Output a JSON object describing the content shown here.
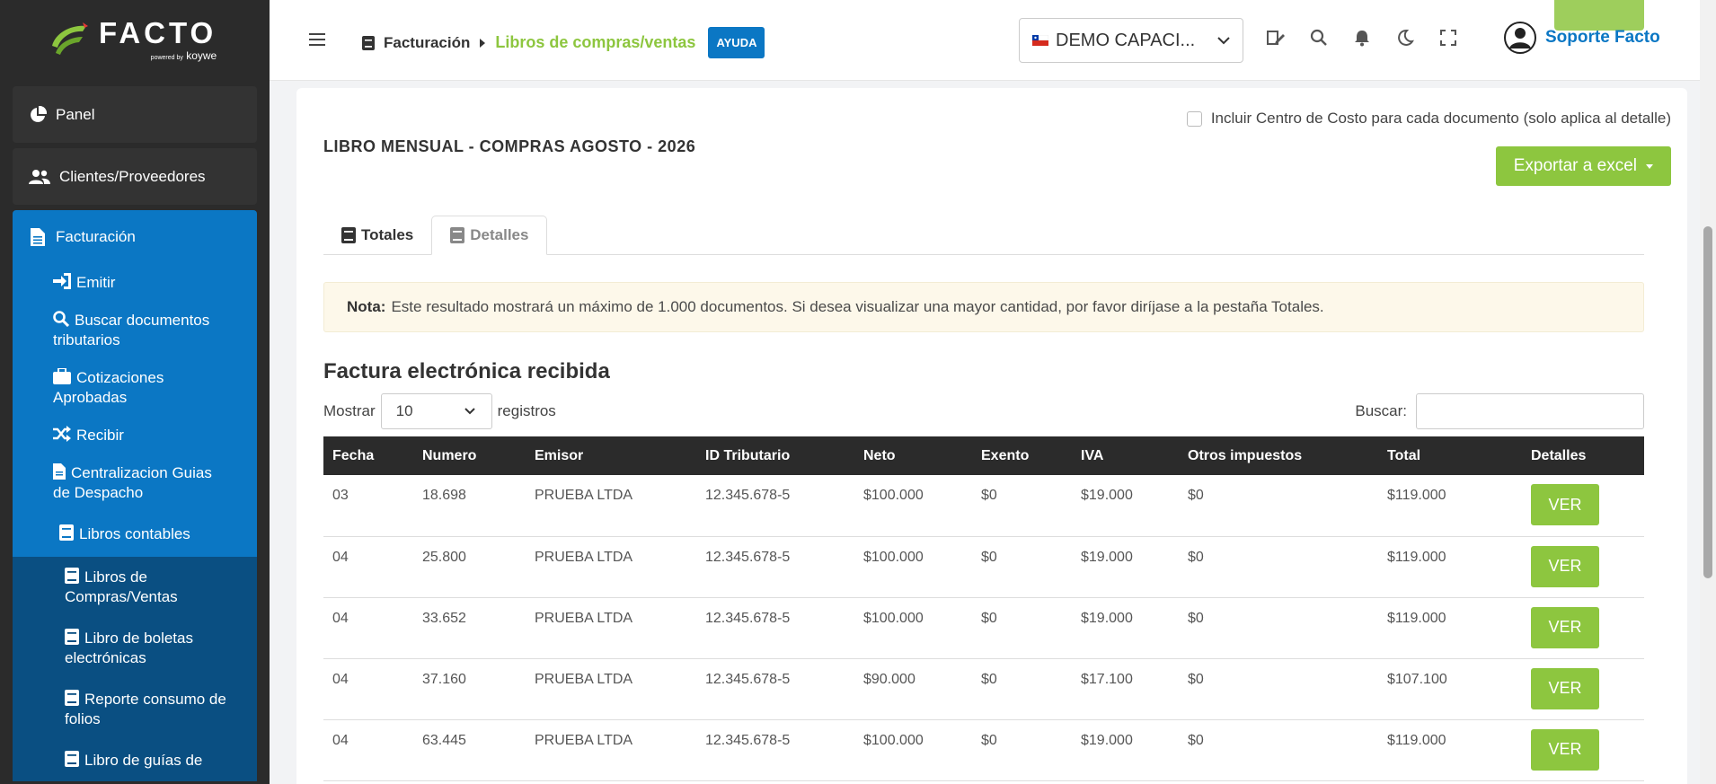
{
  "logo": {
    "word": "FACTO",
    "powered": "powered by",
    "brand": "koywe"
  },
  "sidebar": {
    "panel": "Panel",
    "clients": "Clientes/Proveedores",
    "facturacion": "Facturación",
    "items": [
      {
        "label": "Emitir",
        "icon": "sign-in-icon"
      },
      {
        "label": "Buscar documentos tributarios",
        "icon": "search-icon"
      },
      {
        "label": "Cotizaciones Aprobadas",
        "icon": "briefcase-icon"
      },
      {
        "label": "Recibir",
        "icon": "shuffle-icon"
      },
      {
        "label": "Centralizacion Guias de Despacho",
        "icon": "file-icon"
      }
    ],
    "libros": "Libros contables",
    "libros_items": [
      "Libros de Compras/Ventas",
      "Libro de boletas electrónicas",
      "Reporte consumo de folios",
      "Libro de guías de"
    ]
  },
  "topbar": {
    "breadcrumb_root": "Facturación",
    "breadcrumb_current": "Libros de compras/ventas",
    "help": "AYUDA",
    "company": "DEMO CAPACI...",
    "user": "Soporte Facto"
  },
  "main": {
    "cost_center_label": "Incluir Centro de Costo para cada documento (solo aplica al detalle)",
    "book_title": "LIBRO MENSUAL - COMPRAS AGOSTO - 2026",
    "export_label": "Exportar a excel",
    "tabs": [
      "Totales",
      "Detalles"
    ],
    "note_label": "Nota:",
    "note_text": "Este resultado mostrará un máximo de 1.000 documentos. Si desea visualizar una mayor cantidad, por favor diríjase a la pestaña Totales.",
    "section_title": "Factura electrónica recibida",
    "show_label": "Mostrar",
    "show_value": "10",
    "records_label": "registros",
    "search_label": "Buscar:"
  },
  "table": {
    "headers": [
      "Fecha",
      "Numero",
      "Emisor",
      "ID Tributario",
      "Neto",
      "Exento",
      "IVA",
      "Otros impuestos",
      "Total",
      "Detalles"
    ],
    "rows": [
      [
        "03",
        "18.698",
        "PRUEBA LTDA",
        "12.345.678-5",
        "$100.000",
        "$0",
        "$19.000",
        "$0",
        "$119.000",
        "VER"
      ],
      [
        "04",
        "25.800",
        "PRUEBA LTDA",
        "12.345.678-5",
        "$100.000",
        "$0",
        "$19.000",
        "$0",
        "$119.000",
        "VER"
      ],
      [
        "04",
        "33.652",
        "PRUEBA LTDA",
        "12.345.678-5",
        "$100.000",
        "$0",
        "$19.000",
        "$0",
        "$119.000",
        "VER"
      ],
      [
        "04",
        "37.160",
        "PRUEBA LTDA",
        "12.345.678-5",
        "$90.000",
        "$0",
        "$17.100",
        "$0",
        "$107.100",
        "VER"
      ],
      [
        "04",
        "63.445",
        "PRUEBA LTDA",
        "12.345.678-5",
        "$100.000",
        "$0",
        "$19.000",
        "$0",
        "$119.000",
        "VER"
      ]
    ]
  },
  "colors": {
    "accent_green": "#8dc63f",
    "accent_blue": "#0b77c4",
    "sidebar_bg": "#2b2b2b"
  }
}
